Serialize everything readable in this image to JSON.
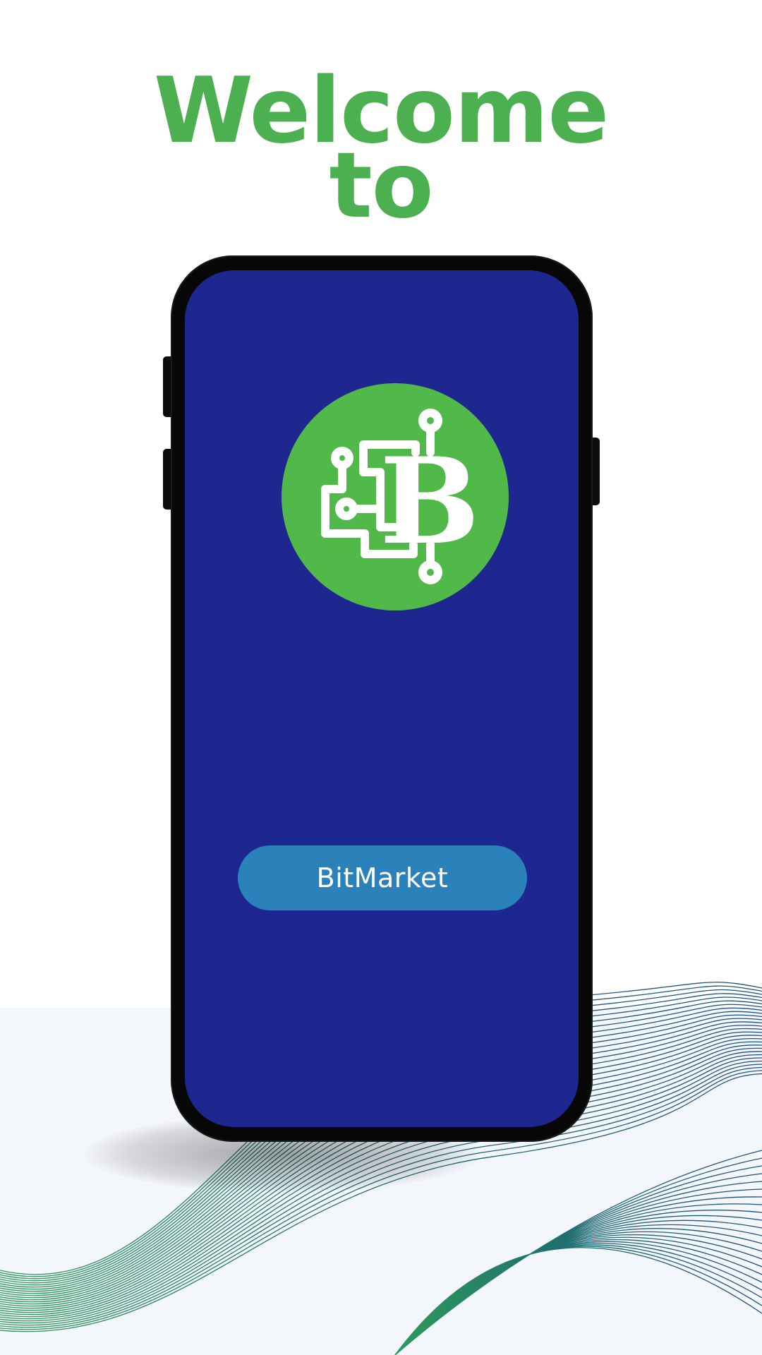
{
  "headline": {
    "line1": "Welcome",
    "line2": "to"
  },
  "brand_button": {
    "label": "BitMarket"
  },
  "logo": {
    "icon": "bitcoin-circuit-logo-icon"
  },
  "colors": {
    "headline": "#4caf50",
    "screen_background": "#1e2690",
    "logo_circle": "#51b949",
    "button": "#2b82ba",
    "page_background": "#ffffff",
    "lower_band": "#f3f6fb"
  }
}
